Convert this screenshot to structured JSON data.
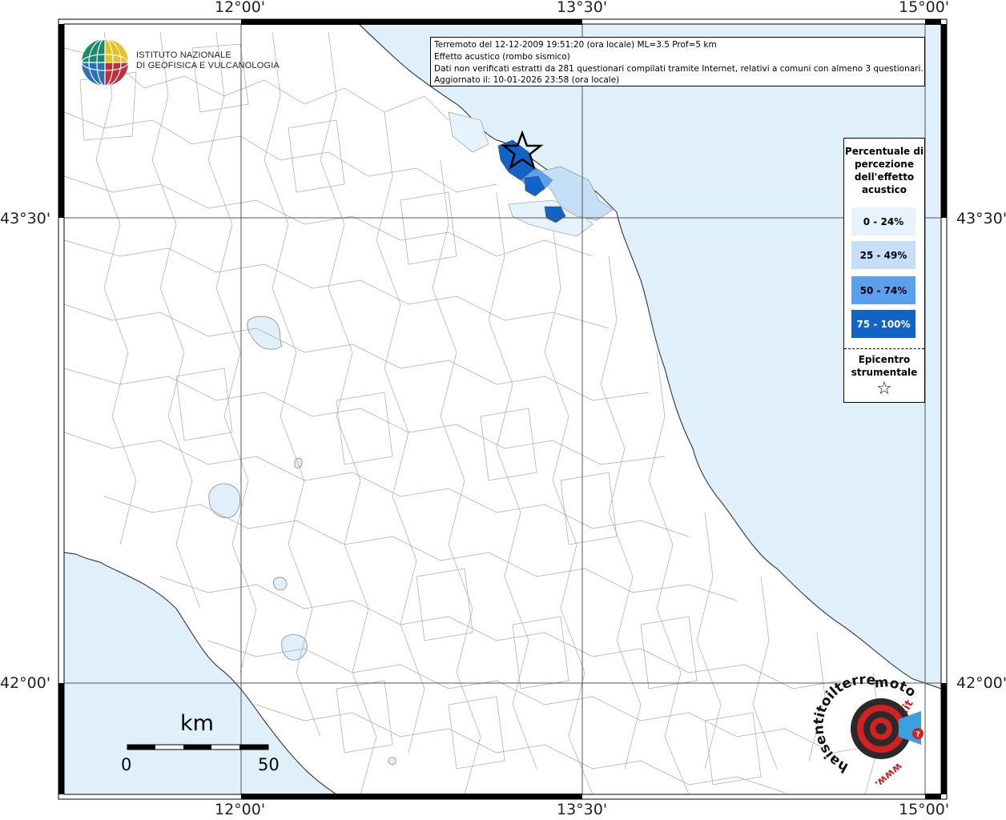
{
  "map": {
    "lon_ticks": [
      "12°00'",
      "13°30'",
      "15°00'"
    ],
    "lat_ticks": [
      "43°30'",
      "42°00'"
    ]
  },
  "logo": {
    "line1": "ISTITUTO NAZIONALE",
    "line2": "DI GEOFISICA E VULCANOLOGIA"
  },
  "info": {
    "line1": "Terremoto del 12-12-2009 19:51:20 (ora locale) ML=3.5 Prof=5 km",
    "line2": "Effetto acustico (rombo sismico)",
    "line3": "Dati non verificati estratti da 281 questionari compilati tramite Internet, relativi a comuni con almeno 3 questionari.",
    "line4": "Aggiornato il: 10-01-2026 23:58 (ora locale)"
  },
  "legend": {
    "title": "Percentuale di percezione dell'effetto acustico",
    "items": [
      {
        "label": "0 - 24%",
        "color": "#e6f3fd"
      },
      {
        "label": "25 - 49%",
        "color": "#c6dff8"
      },
      {
        "label": "50 - 74%",
        "color": "#5ba0ee"
      },
      {
        "label": "75 - 100%",
        "color": "#1163c8"
      }
    ],
    "epicenter_label": "Epicentro strumentale",
    "epicenter_symbol": "☆"
  },
  "scale": {
    "unit": "km",
    "start": "0",
    "end": "50"
  },
  "badge": {
    "text_main": "haisentitoilterremoto",
    "text_it": ".it",
    "text_www": "www."
  },
  "colors": {
    "sea": "#dff0fb",
    "land": "#ffffff",
    "border": "#999999",
    "grid": "#555555"
  }
}
